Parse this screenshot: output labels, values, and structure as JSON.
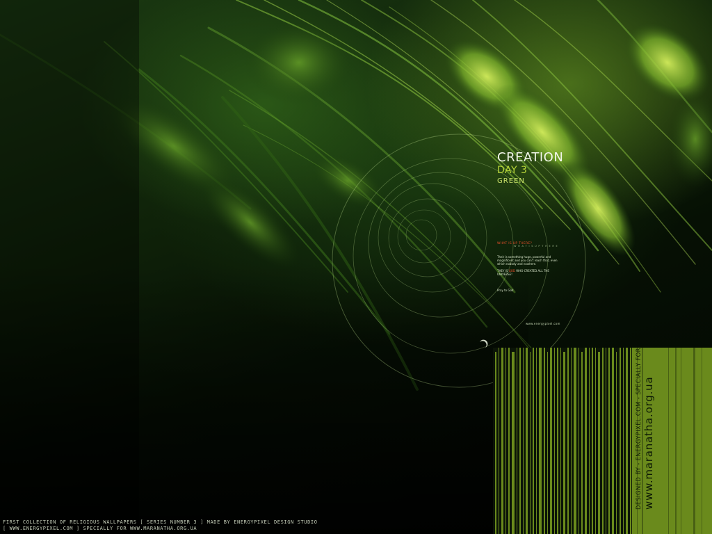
{
  "title": {
    "main": "CREATION",
    "day": "DAY 3",
    "color_word": "GREEN"
  },
  "info": {
    "question": "WHAT IS UP THERE?",
    "question_sub": "W H A T   I S   U P   T H E R E",
    "paragraph_1": "Their is something huge, powerful and magnificent and you can't reach that, even which nobody and nowhere.",
    "paragraph_2_before": "THEY IS ",
    "paragraph_2_highlight": "GOD",
    "paragraph_2_after": " WHO CREATED ALL THE UNIVERSE!",
    "paragraph_3": "Pray to God",
    "url": "www.energypixel.com"
  },
  "credit": {
    "designed_by": "DESIGNED BY - ENERGYPIXEL.COM - SPECIALLY FOR",
    "site": "www.maranatha.org.ua"
  },
  "footer": {
    "line_1": "FIRST COLLECTION OF RELIGIOUS WALLPAPERS  [ SERIES NUMBER 3 ] MADE BY ENERGYPIXEL DESIGN STUDIO",
    "line_2": "[ WWW.ENERGYPIXEL.COM ] SPECIALLY FOR WWW.MARANATHA.ORG.UA"
  },
  "colors": {
    "accent_green": "#b8d63a",
    "barcode_green": "#6a8a1c",
    "highlight_red": "#e8502a",
    "background_dark": "#050805"
  }
}
